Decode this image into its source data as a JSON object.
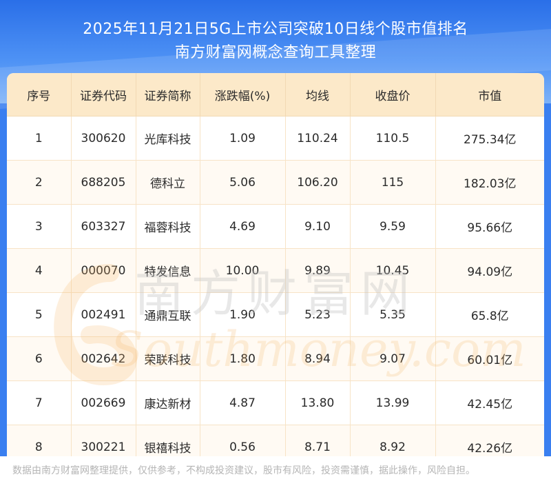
{
  "header": {
    "title_line1": "2025年11月21日5G上市公司突破10日线个股市值排名",
    "title_line2": "南方财富网概念查询工具整理"
  },
  "table": {
    "columns": [
      "序号",
      "证券代码",
      "证券简称",
      "涨跌幅(%)",
      "均线",
      "收盘价",
      "市值"
    ],
    "rows": [
      [
        "1",
        "300620",
        "光库科技",
        "1.09",
        "110.24",
        "110.5",
        "275.34亿"
      ],
      [
        "2",
        "688205",
        "德科立",
        "5.06",
        "106.20",
        "115",
        "182.03亿"
      ],
      [
        "3",
        "603327",
        "福蓉科技",
        "4.69",
        "9.10",
        "9.59",
        "95.66亿"
      ],
      [
        "4",
        "000070",
        "特发信息",
        "10.00",
        "9.89",
        "10.45",
        "94.09亿"
      ],
      [
        "5",
        "002491",
        "通鼎互联",
        "1.90",
        "5.23",
        "5.35",
        "65.8亿"
      ],
      [
        "6",
        "002642",
        "荣联科技",
        "1.80",
        "8.94",
        "9.07",
        "60.01亿"
      ],
      [
        "7",
        "002669",
        "康达新材",
        "4.87",
        "13.80",
        "13.99",
        "42.45亿"
      ],
      [
        "8",
        "300221",
        "银禧科技",
        "0.56",
        "8.71",
        "8.92",
        "42.26亿"
      ]
    ]
  },
  "watermark": {
    "logo_text": "南方财富网",
    "logo_script": "Southmoney.com"
  },
  "footer": {
    "disclaimer": "数据由南方财富网整理提供，仅供参考，不构成投资建议，股市有风险，投资需谨慎，据此操作，风险自担。"
  },
  "colors": {
    "header_blue": "#2a6fe8",
    "table_header_bg": "#fce9c9",
    "watermark_orange": "#f6b76a"
  }
}
